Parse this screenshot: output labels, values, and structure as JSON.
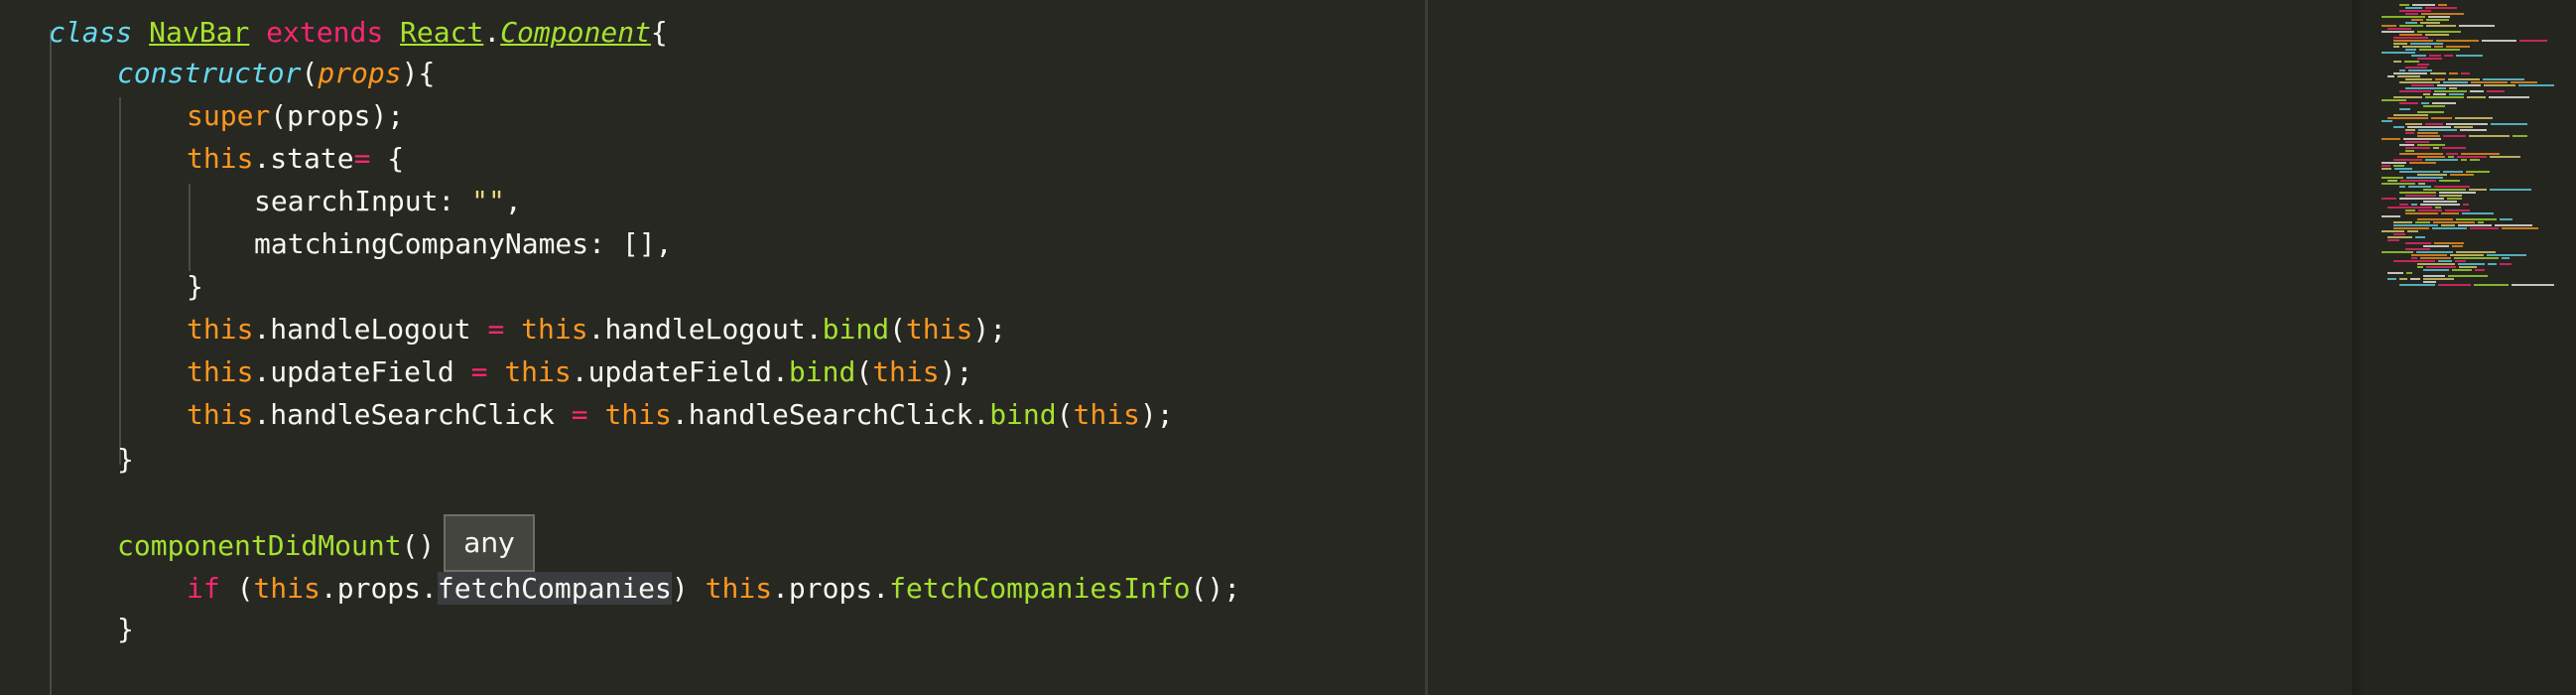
{
  "editor": {
    "lines": [
      {
        "parts": [
          "class",
          " ",
          "NavBar",
          " ",
          "extends",
          " ",
          "React",
          ".",
          "Component",
          "{"
        ]
      },
      {
        "parts": [
          "constructor",
          "(",
          "props",
          "){"
        ]
      },
      {
        "parts": [
          "super",
          "(props);"
        ]
      },
      {
        "parts": [
          "this",
          ".state",
          "=",
          " {"
        ]
      },
      {
        "parts": [
          "searchInput: ",
          "\"\"",
          ","
        ]
      },
      {
        "parts": [
          "matchingCompanyNames: [],"
        ]
      },
      {
        "parts": [
          "}"
        ]
      },
      {
        "parts": [
          "this",
          ".handleLogout ",
          "=",
          " ",
          "this",
          ".handleLogout.",
          "bind",
          "(",
          "this",
          ");"
        ]
      },
      {
        "parts": [
          "this",
          ".updateField ",
          "=",
          " ",
          "this",
          ".updateField.",
          "bind",
          "(",
          "this",
          ");"
        ]
      },
      {
        "parts": [
          "this",
          ".handleSearchClick ",
          "=",
          " ",
          "this",
          ".handleSearchClick.",
          "bind",
          "(",
          "this",
          ");"
        ]
      },
      {
        "parts": [
          "}"
        ]
      },
      {
        "parts": [
          "componentDidMount",
          "()"
        ]
      },
      {
        "parts": [
          "if",
          " (",
          "this",
          ".props.",
          "fetchCompanies",
          ") ",
          "this",
          ".props.",
          "fetchCompaniesInfo",
          "();"
        ]
      },
      {
        "parts": [
          "}"
        ]
      }
    ],
    "tooltip": "any"
  },
  "theme": {
    "background": "#272822",
    "keyword": "#F92672",
    "string": "#E6DB74",
    "this": "#FD971F",
    "function": "#A6E22E",
    "storage": "#66D9EF",
    "text": "#F8F8F2"
  }
}
